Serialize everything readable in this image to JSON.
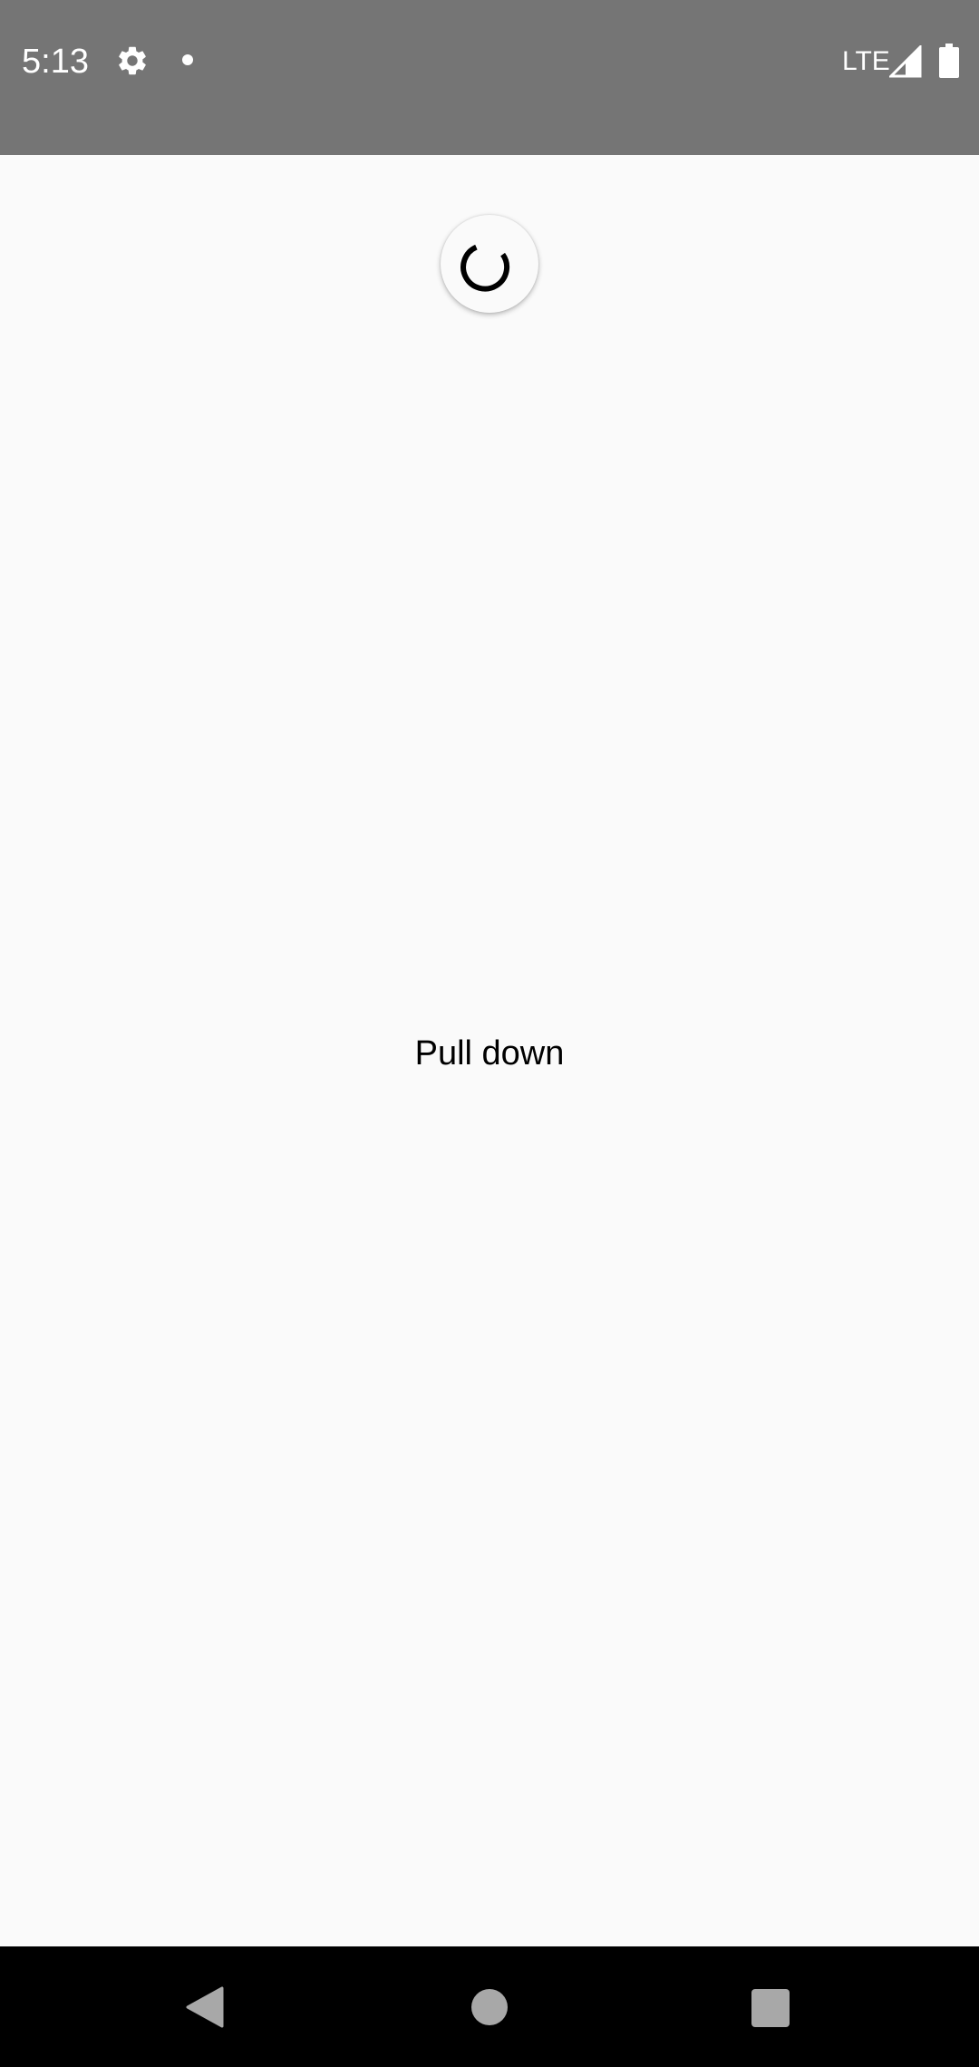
{
  "status_bar": {
    "time": "5:13",
    "network": "LTE",
    "background": "#757575",
    "icons": [
      "gear-icon",
      "notification-dot-icon",
      "signal-icon",
      "battery-icon"
    ]
  },
  "main": {
    "message": "Pull down",
    "refresh_indicator": "progress-spinner"
  },
  "nav_bar": {
    "buttons": [
      "back",
      "home",
      "recents"
    ]
  }
}
